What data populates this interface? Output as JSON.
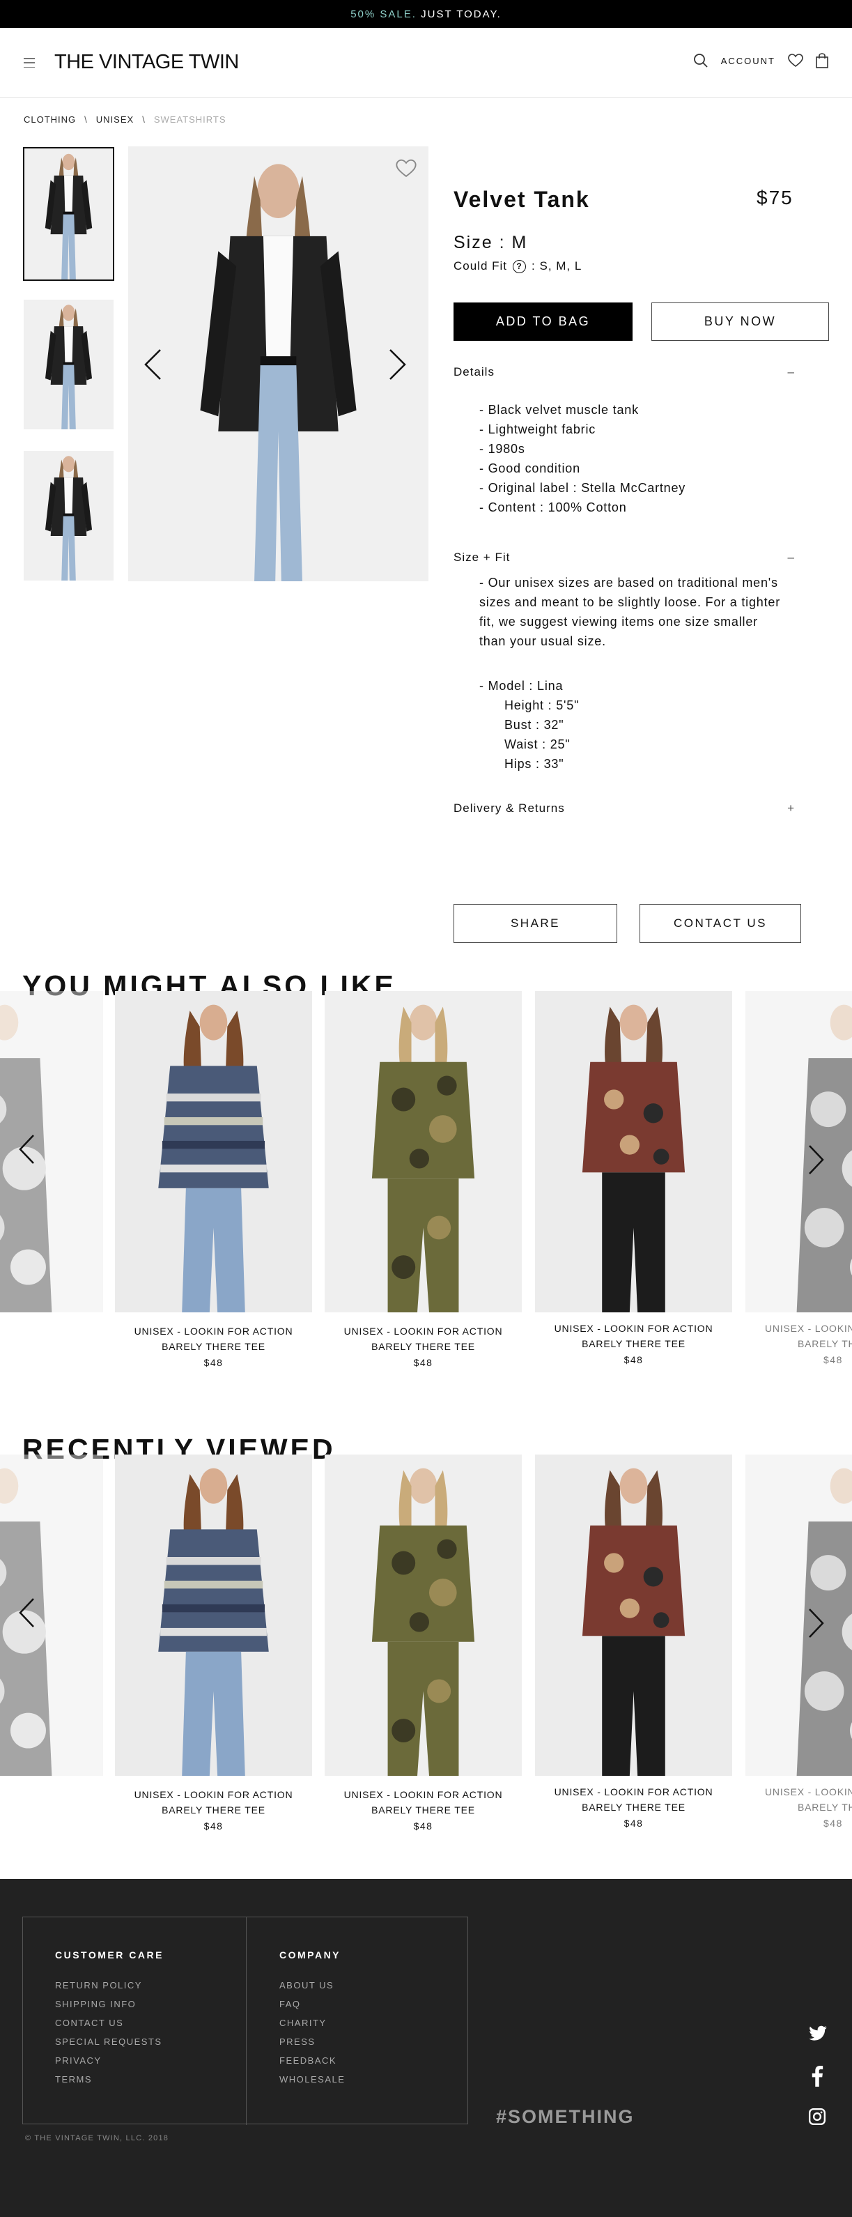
{
  "promo": {
    "accent": "50% SALE.",
    "rest": "JUST TODAY."
  },
  "header": {
    "logo": "THE VINTAGE TWIN",
    "account": "ACCOUNT"
  },
  "breadcrumb": {
    "items": [
      "CLOTHING",
      "UNISEX",
      "SWEATSHIRTS"
    ],
    "separator": "\\"
  },
  "product": {
    "title": "Velvet Tank",
    "price": "$75",
    "size": "Size : M",
    "could_fit_label": "Could Fit",
    "could_fit_sizes": ": S, M, L",
    "add_to_bag": "ADD TO BAG",
    "buy_now": "BUY NOW"
  },
  "details": {
    "heading": "Details",
    "toggle": "–",
    "items": [
      "- Black velvet muscle tank",
      "- Lightweight fabric",
      "- 1980s",
      "- Good condition",
      "- Original label : Stella McCartney",
      "- Content : 100% Cotton"
    ]
  },
  "size_fit": {
    "heading": "Size + Fit",
    "toggle": "–",
    "paragraph": "- Our unisex sizes are based on traditional men's sizes and meant to be slightly loose. For a tighter fit, we suggest viewing items one size smaller than your usual size.",
    "model": "- Model : Lina",
    "measurements": [
      "Height : 5'5\"",
      "Bust : 32\"",
      "Waist : 25\"",
      "Hips : 33\""
    ]
  },
  "delivery": {
    "heading": "Delivery & Returns",
    "toggle": "+"
  },
  "actions": {
    "share": "SHARE",
    "contact": "CONTACT US"
  },
  "also_like": {
    "title": "YOU MIGHT ALSO LIKE",
    "cards": [
      {
        "name_line1": "UNISEX - LOOKIN FOR ACTION",
        "name_line2": "BARELY THERE TEE",
        "price": "$48"
      },
      {
        "name_line1": "UNISEX - LOOKIN FOR ACTION",
        "name_line2": "BARELY THERE TEE",
        "price": "$48"
      },
      {
        "name_line1": "UNISEX - LOOKIN FOR ACTION",
        "name_line2": "BARELY THERE TEE",
        "price": "$48"
      },
      {
        "name_line1": "UNISEX - LOOKIN",
        "name_line2": "BARELY TH",
        "price": "$48"
      }
    ]
  },
  "recently_viewed": {
    "title": "RECENTLY VIEWED",
    "cards": [
      {
        "name_line1": "UNISEX - LOOKIN FOR ACTION",
        "name_line2": "BARELY THERE TEE",
        "price": "$48"
      },
      {
        "name_line1": "UNISEX - LOOKIN FOR ACTION",
        "name_line2": "BARELY THERE TEE",
        "price": "$48"
      },
      {
        "name_line1": "UNISEX - LOOKIN FOR ACTION",
        "name_line2": "BARELY THERE TEE",
        "price": "$48"
      },
      {
        "name_line1": "UNISEX - LOOKIN",
        "name_line2": "BARELY TH",
        "price": "$48"
      }
    ]
  },
  "footer": {
    "customer_care": {
      "heading": "CUSTOMER CARE",
      "links": [
        "RETURN POLICY",
        "SHIPPING INFO",
        "CONTACT US",
        "SPECIAL REQUESTS",
        "PRIVACY",
        "TERMS"
      ]
    },
    "company": {
      "heading": "COMPANY",
      "links": [
        "ABOUT US",
        "FAQ",
        "CHARITY",
        "PRESS",
        "FEEDBACK",
        "WHOLESALE"
      ]
    },
    "copyright": "© THE VINTAGE TWIN, LLC. 2018",
    "hashtag": "#SOMETHING",
    "social": [
      "twitter-icon",
      "facebook-icon",
      "instagram-icon"
    ]
  },
  "colors": {
    "promo_accent": "#8fd0c9",
    "footer_bg": "#222222",
    "button_black": "#000000"
  }
}
